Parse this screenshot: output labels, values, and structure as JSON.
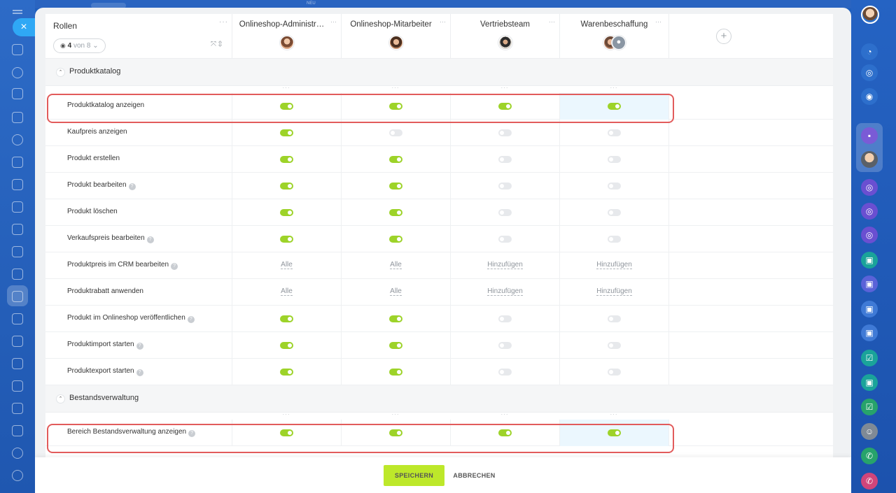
{
  "topbar": {
    "new_badge": "NEU"
  },
  "close_label": "×",
  "header": {
    "roles_title": "Rollen",
    "dots": "···",
    "count_current": "4",
    "count_suffix": "von 8",
    "columns": [
      {
        "name": "Onlineshop-Administr…"
      },
      {
        "name": "Onlineshop-Mitarbeiter"
      },
      {
        "name": "Vertriebsteam"
      },
      {
        "name": "Warenbeschaffung"
      }
    ],
    "add_label": "+"
  },
  "sections": [
    {
      "title": "Produktkatalog",
      "rows": [
        {
          "label": "Produktkatalog anzeigen",
          "help": false,
          "values": [
            "on",
            "on",
            "on",
            "on"
          ]
        },
        {
          "label": "Kaufpreis anzeigen",
          "help": false,
          "values": [
            "on",
            "off",
            "off",
            "off"
          ]
        },
        {
          "label": "Produkt erstellen",
          "help": false,
          "values": [
            "on",
            "on",
            "off",
            "off"
          ]
        },
        {
          "label": "Produkt bearbeiten",
          "help": true,
          "values": [
            "on",
            "on",
            "off",
            "off"
          ]
        },
        {
          "label": "Produkt löschen",
          "help": false,
          "values": [
            "on",
            "on",
            "off",
            "off"
          ]
        },
        {
          "label": "Verkaufspreis bearbeiten",
          "help": true,
          "values": [
            "on",
            "on",
            "off",
            "off"
          ]
        },
        {
          "label": "Produktpreis im CRM bearbeiten",
          "help": true,
          "values": [
            "Alle",
            "Alle",
            "Hinzufügen",
            "Hinzufügen"
          ]
        },
        {
          "label": "Produktrabatt anwenden",
          "help": false,
          "values": [
            "Alle",
            "Alle",
            "Hinzufügen",
            "Hinzufügen"
          ]
        },
        {
          "label": "Produkt im Onlineshop veröffentlichen",
          "help": true,
          "values": [
            "on",
            "on",
            "off",
            "off"
          ]
        },
        {
          "label": "Produktimport starten",
          "help": true,
          "values": [
            "on",
            "on",
            "off",
            "off"
          ]
        },
        {
          "label": "Produktexport starten",
          "help": true,
          "values": [
            "on",
            "on",
            "off",
            "off"
          ]
        }
      ]
    },
    {
      "title": "Bestandsverwaltung",
      "rows": [
        {
          "label": "Bereich Bestandsverwaltung anzeigen",
          "help": true,
          "values": [
            "on",
            "on",
            "on",
            "on"
          ]
        }
      ]
    }
  ],
  "footer": {
    "save_label": "SPEICHERN",
    "cancel_label": "ABBRECHEN"
  },
  "colors": {
    "toggle_on": "#9dd329",
    "highlight": "#e25b5b",
    "save_button": "#bde82a"
  }
}
